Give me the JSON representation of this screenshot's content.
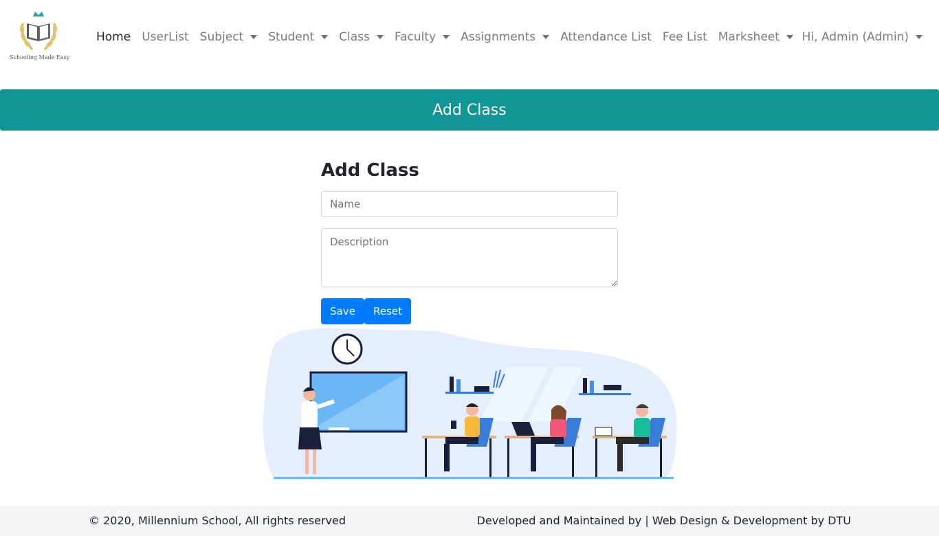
{
  "brand": {
    "tagline": "Schooling Made Easy",
    "logo_icon": "crowned-open-book-laurel-icon"
  },
  "nav": {
    "items": [
      {
        "label": "Home"
      },
      {
        "label": "UserList"
      },
      {
        "label": "Subject"
      },
      {
        "label": "Student"
      },
      {
        "label": "Class"
      },
      {
        "label": "Faculty"
      },
      {
        "label": "Assignments"
      },
      {
        "label": "Attendance List"
      },
      {
        "label": "Fee List"
      },
      {
        "label": "Marksheet"
      }
    ],
    "user": "Hi, Admin (Admin)"
  },
  "banner": {
    "title": "Add Class"
  },
  "form": {
    "title": "Add Class",
    "name_placeholder": "Name",
    "description_placeholder": "Description",
    "save_label": "Save",
    "reset_label": "Reset"
  },
  "footer": {
    "copyright": "© 2020, Millennium School, All rights reserved",
    "credit": "Developed and Maintained by | Web Design & Development by DTU"
  },
  "colors": {
    "banner": "#109494",
    "button": "#007bff",
    "footer_bg": "#f4f5f7"
  }
}
